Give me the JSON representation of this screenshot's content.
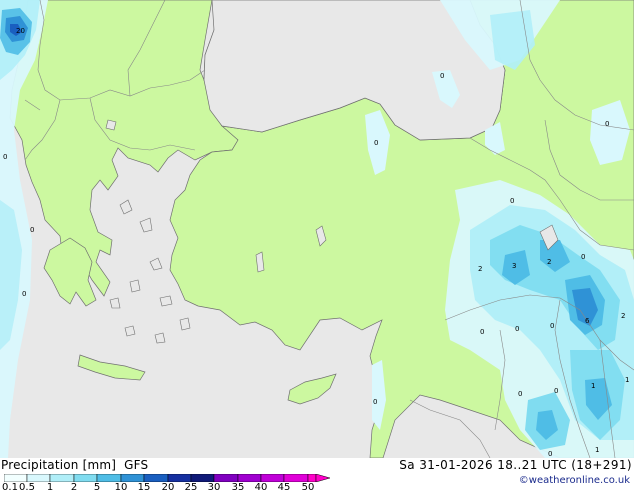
{
  "map": {
    "contour_labels": [
      "20",
      "0",
      "0",
      "0",
      "0",
      "0",
      "0",
      "0",
      "0",
      "0",
      "2",
      "3",
      "2",
      "0",
      "0",
      "0",
      "6",
      "2",
      "0",
      "0",
      "0",
      "1",
      "1",
      "1"
    ]
  },
  "legend": {
    "title": "Precipitation [mm]",
    "model": "GFS",
    "valid_time": "Sa 31-01-2026 18..21 UTC (18+291)",
    "credit": "©weatheronline.co.uk",
    "ticks": [
      "0.1",
      "0.5",
      "1",
      "2",
      "5",
      "10",
      "15",
      "20",
      "25",
      "30",
      "35",
      "40",
      "45",
      "50"
    ],
    "colors": [
      "#f2ffff",
      "#d9f8fd",
      "#b0eef8",
      "#80dcf0",
      "#4fbde6",
      "#2f92d6",
      "#1a5fc0",
      "#1630a0",
      "#101a78",
      "#8000c0",
      "#a000d0",
      "#c000d8",
      "#e000d8",
      "#ff00c8"
    ]
  },
  "colors": {
    "land": "#ccf8a0",
    "sea": "#e8e8e8",
    "border": "#888888",
    "coast": "#707070"
  }
}
